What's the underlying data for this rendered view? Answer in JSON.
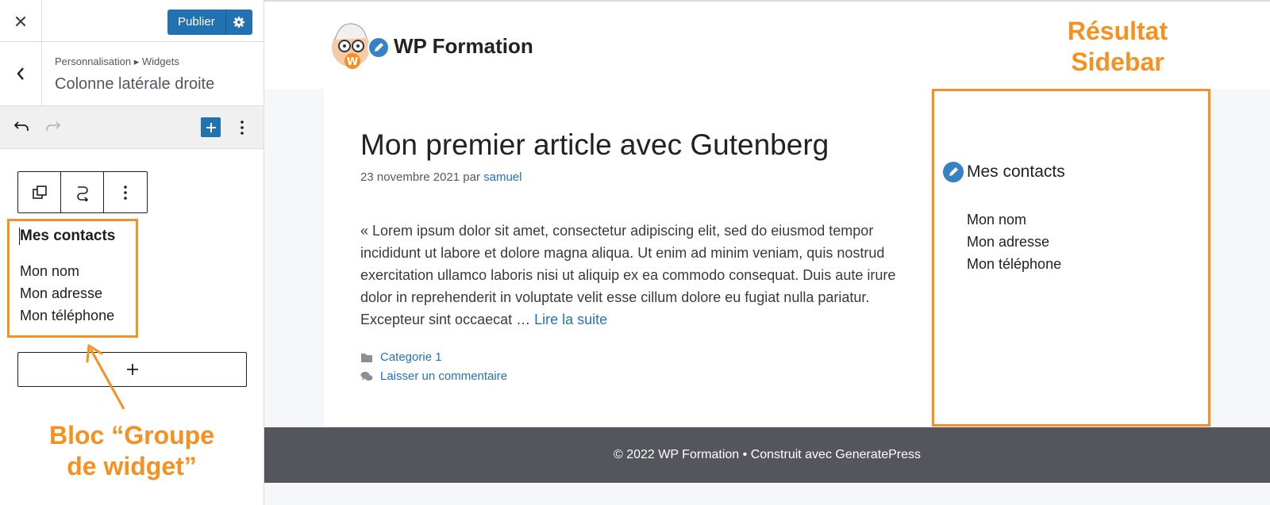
{
  "panel": {
    "publish_label": "Publier",
    "breadcrumb": "Personnalisation ▸ Widgets",
    "title": "Colonne latérale droite",
    "widget_group": {
      "title": "Mes contacts",
      "lines": [
        "Mon nom",
        "Mon adresse",
        "Mon téléphone"
      ]
    },
    "annotation": {
      "line1": "Bloc “Groupe",
      "line2": "de widget”"
    }
  },
  "preview": {
    "site_name": "WP Formation",
    "annotation": {
      "line1": "Résultat",
      "line2": "Sidebar"
    },
    "post": {
      "title": "Mon premier article avec Gutenberg",
      "date": "23 novembre 2021",
      "by": "par",
      "author": "samuel",
      "excerpt": "« Lorem ipsum dolor sit amet, consectetur adipiscing elit, sed do eiusmod tempor incididunt ut labore et dolore magna aliqua. Ut enim ad minim veniam, quis nostrud exercitation ullamco laboris nisi ut aliquip ex ea commodo consequat. Duis aute irure dolor in reprehenderit in voluptate velit esse cillum dolore eu fugiat nulla pariatur. Excepteur sint occaecat …",
      "read_more": "Lire la suite",
      "category": "Categorie 1",
      "comment_link": "Laisser un commentaire"
    },
    "sidebar": {
      "title": "Mes contacts",
      "lines": [
        "Mon nom",
        "Mon adresse",
        "Mon téléphone"
      ]
    },
    "footer": "© 2022 WP Formation • Construit avec GeneratePress"
  },
  "colors": {
    "accent": "#2271b1",
    "annotation": "#f7901e",
    "link": "#1e73be",
    "footer_bg": "#55555e"
  },
  "icons": [
    "close-icon",
    "settings-gear-icon",
    "chevron-left-icon",
    "undo-icon",
    "redo-icon",
    "plus-icon",
    "more-vertical-icon",
    "duplicate-icon",
    "transform-icon",
    "pencil-edit-icon",
    "folder-icon",
    "comments-icon",
    "arrow-icon"
  ]
}
